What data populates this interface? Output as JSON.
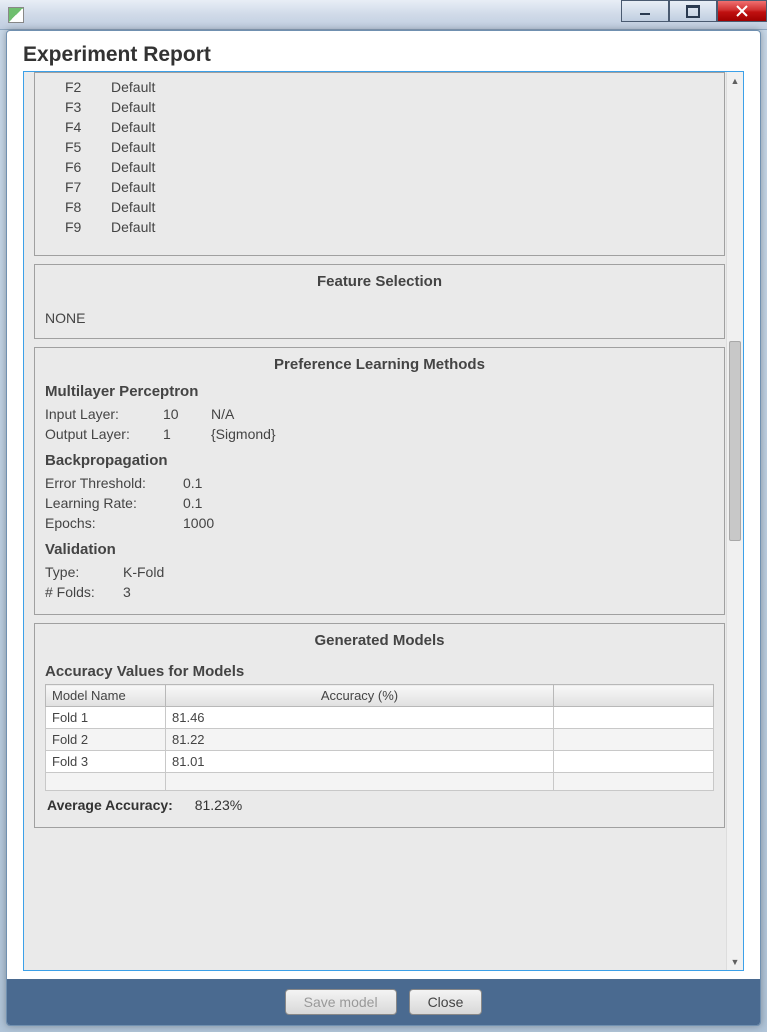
{
  "window": {
    "report_title": "Experiment Report"
  },
  "features": [
    {
      "name": "F2",
      "val": "Default"
    },
    {
      "name": "F3",
      "val": "Default"
    },
    {
      "name": "F4",
      "val": "Default"
    },
    {
      "name": "F5",
      "val": "Default"
    },
    {
      "name": "F6",
      "val": "Default"
    },
    {
      "name": "F7",
      "val": "Default"
    },
    {
      "name": "F8",
      "val": "Default"
    },
    {
      "name": "F9",
      "val": "Default"
    }
  ],
  "feature_selection": {
    "title": "Feature Selection",
    "value": "NONE"
  },
  "plm": {
    "title": "Preference Learning Methods",
    "mlp_heading": "Multilayer Perceptron",
    "input_layer_label": "Input Layer:",
    "input_layer_n": "10",
    "input_layer_act": "N/A",
    "output_layer_label": "Output Layer:",
    "output_layer_n": "1",
    "output_layer_act": "{Sigmond}",
    "bp_heading": "Backpropagation",
    "err_label": "Error Threshold:",
    "err_val": "0.1",
    "lr_label": "Learning Rate:",
    "lr_val": "0.1",
    "epochs_label": "Epochs:",
    "epochs_val": "1000",
    "val_heading": "Validation",
    "type_label": "Type:",
    "type_val": "K-Fold",
    "folds_label": "# Folds:",
    "folds_val": "3"
  },
  "models": {
    "title": "Generated Models",
    "subtitle": "Accuracy Values for Models",
    "col_model": "Model Name",
    "col_acc": "Accuracy (%)",
    "rows": [
      {
        "name": "Fold 1",
        "acc": "81.46"
      },
      {
        "name": "Fold 2",
        "acc": "81.22"
      },
      {
        "name": "Fold 3",
        "acc": "81.01"
      }
    ],
    "avg_label": "Average Accuracy:",
    "avg_val": "81.23%"
  },
  "buttons": {
    "save": "Save model",
    "close": "Close"
  },
  "chart_data": {
    "type": "table",
    "title": "Accuracy Values for Models",
    "columns": [
      "Model Name",
      "Accuracy (%)"
    ],
    "rows": [
      [
        "Fold 1",
        81.46
      ],
      [
        "Fold 2",
        81.22
      ],
      [
        "Fold 3",
        81.01
      ]
    ],
    "summary": {
      "Average Accuracy": 81.23
    }
  }
}
